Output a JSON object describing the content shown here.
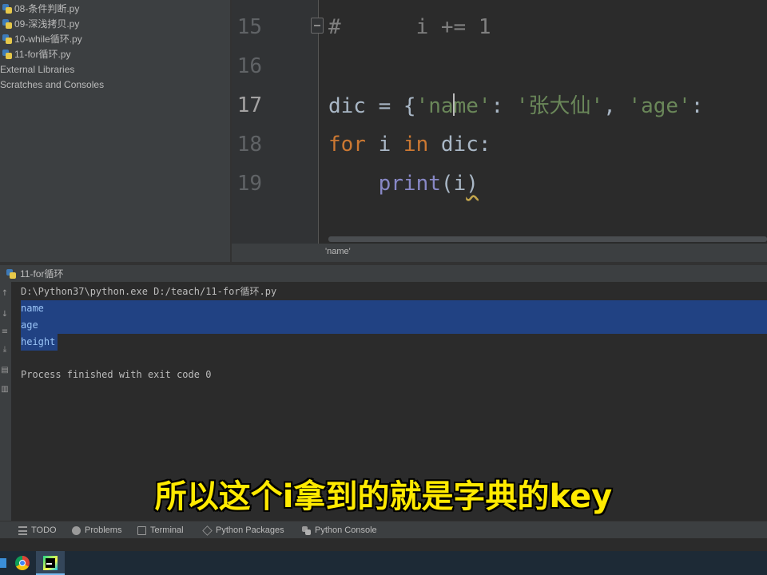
{
  "project_tree": {
    "items": [
      {
        "label": "08-条件判断.py",
        "type": "py-file"
      },
      {
        "label": "09-深浅拷贝.py",
        "type": "py-file"
      },
      {
        "label": "10-while循环.py",
        "type": "py-file"
      },
      {
        "label": "11-for循环.py",
        "type": "py-file"
      },
      {
        "label": "External Libraries",
        "type": "folder"
      },
      {
        "label": "Scratches and Consoles",
        "type": "folder"
      }
    ]
  },
  "editor": {
    "line_numbers": [
      "15",
      "16",
      "17",
      "18",
      "19"
    ],
    "current_line": "17",
    "lines": {
      "l15": {
        "comment_hash": "#",
        "comment_body": "      i += 1"
      },
      "l17": {
        "var": "dic",
        "op": " = {",
        "str_q1": "'",
        "str_name_a": "na",
        "str_name_b": "me",
        "str_q2": "'",
        "colon1": ": ",
        "str_value": "'张大仙'",
        "comma": ", ",
        "str_age": "'age'",
        "colon2": ":"
      },
      "l18": {
        "kw_for": "for",
        "var_i": " i ",
        "kw_in": "in",
        "rest": " dic:"
      },
      "l19": {
        "indent": "    ",
        "fn": "print",
        "open": "(",
        "arg": "i",
        "close": ")"
      }
    },
    "breadcrumb": "'name'"
  },
  "run_panel": {
    "tab_label": "11-for循环",
    "console_lines": [
      {
        "text": "D:\\Python37\\python.exe D:/teach/11-for循环.py",
        "selected": false
      },
      {
        "text": "name",
        "selected": true
      },
      {
        "text": "age",
        "selected": true
      },
      {
        "text": "height",
        "selected": true
      },
      {
        "text": "",
        "selected": false
      },
      {
        "text": "Process finished with exit code 0",
        "selected": false
      }
    ]
  },
  "subtitle": "所以这个i拿到的就是字典的key",
  "bottom_tabs": [
    {
      "label": "TODO",
      "icon": "todo-icon"
    },
    {
      "label": "Problems",
      "icon": "problems-icon"
    },
    {
      "label": "Terminal",
      "icon": "terminal-icon"
    },
    {
      "label": "Python Packages",
      "icon": "packages-icon"
    },
    {
      "label": "Python Console",
      "icon": "python-console-icon"
    }
  ],
  "taskbar": {
    "apps": [
      "windows-start-icon",
      "chrome-icon",
      "pycharm-icon"
    ],
    "active_app": "pycharm-icon"
  },
  "colors": {
    "keyword": "#cc7832",
    "string": "#6a8759",
    "comment": "#808080",
    "builtin": "#8888c6",
    "selection": "#214283",
    "subtitle": "#ffea00"
  }
}
